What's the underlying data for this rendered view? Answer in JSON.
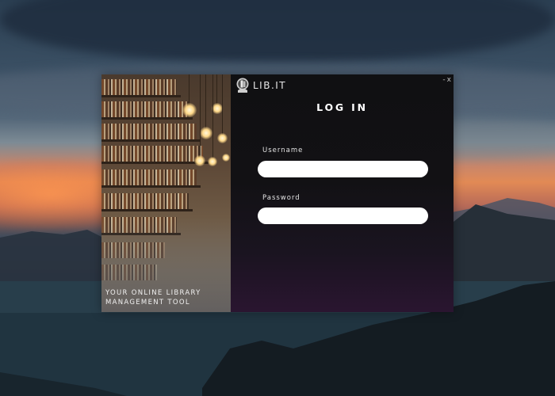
{
  "app": {
    "brand_name": "LIB.IT",
    "window_controls": {
      "minimize": "-",
      "close": "x"
    }
  },
  "hero": {
    "tagline_line1": "YOUR ONLINE LIBRARY",
    "tagline_line2": "MANAGEMENT TOOL"
  },
  "login": {
    "title": "LOG IN",
    "username_label": "Username",
    "username_value": "",
    "password_label": "Password",
    "password_value": ""
  },
  "colors": {
    "form_background": "#101012",
    "input_background": "#ffffff",
    "text": "#ffffff"
  },
  "icons": {
    "brand_logo": "book-lamp-logo-icon"
  }
}
